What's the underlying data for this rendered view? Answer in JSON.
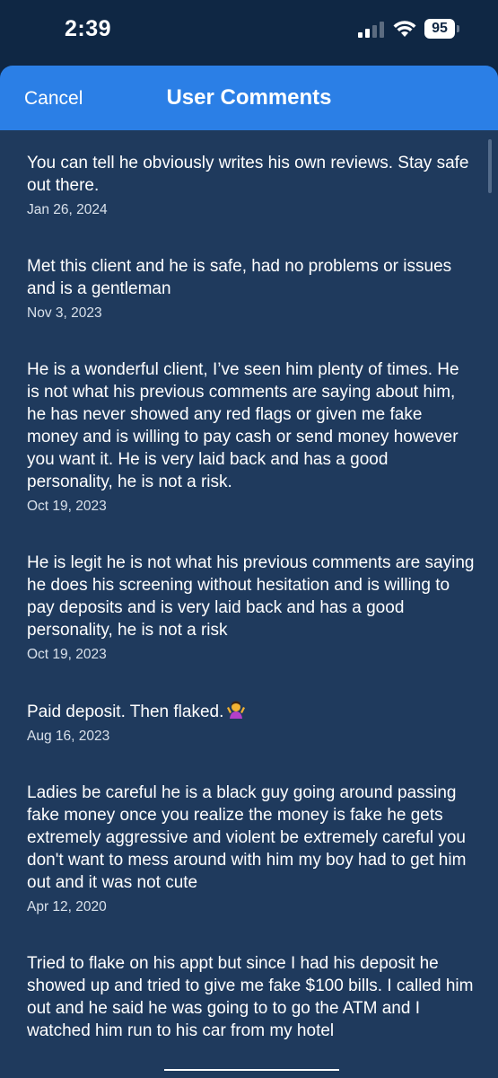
{
  "status_bar": {
    "time": "2:39",
    "battery": "95"
  },
  "nav": {
    "cancel_label": "Cancel",
    "title": "User Comments"
  },
  "comments": [
    {
      "text": "You can tell he obviously writes his own reviews. Stay safe out there.",
      "date": "Jan 26, 2024"
    },
    {
      "text": "Met this client and he is safe, had no problems or issues and is a gentleman",
      "date": "Nov 3, 2023"
    },
    {
      "text": "He is a wonderful client, I’ve seen him plenty of times. He is not what his previous comments are saying about him, he has never showed any red flags or given me fake money and is willing to pay cash or send money however you want it. He is very laid back and has a good personality, he is not a risk.",
      "date": "Oct 19, 2023"
    },
    {
      "text": "He is legit he is not what his previous comments are saying he does his screening without hesitation and is willing to pay deposits and is very laid back and has a good personality, he is not a risk",
      "date": "Oct 19, 2023"
    },
    {
      "text": "Paid deposit. Then flaked.",
      "emoji": "woman-shrugging-icon",
      "date": "Aug 16, 2023"
    },
    {
      "text": "Ladies be careful he is a black guy going around passing fake money  once you realize the money is fake he gets extremely aggressive and violent be extremely careful you don't want to mess around with him my boy had to get him out and it was not cute",
      "date": "Apr 12, 2020"
    },
    {
      "text": "Tried to flake on his appt but since I had his deposit he showed up and tried to give me fake $100 bills. I called him out and he said he was going to to go the ATM and I watched him run to his car from my hotel"
    }
  ]
}
